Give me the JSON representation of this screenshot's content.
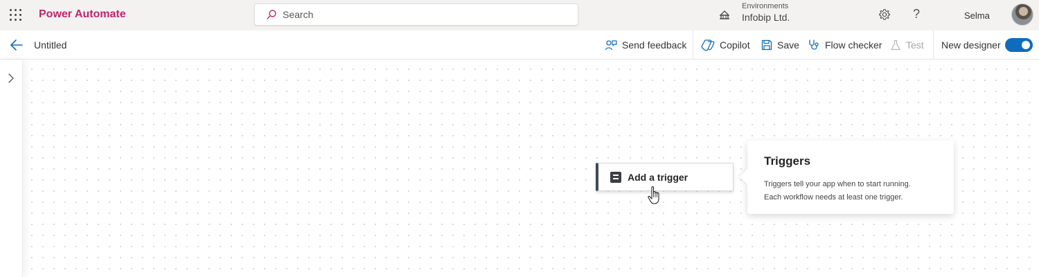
{
  "appbar": {
    "brand": "Power Automate",
    "search_placeholder": "Search",
    "environment_label": "Environments",
    "environment_value": "Infobip Ltd.",
    "help": "?",
    "user_name": "Selma"
  },
  "cmdbar": {
    "title": "Untitled",
    "send_feedback": "Send feedback",
    "copilot": "Copilot",
    "save": "Save",
    "flow_checker": "Flow checker",
    "test": "Test",
    "new_designer": "New designer",
    "new_designer_on": true
  },
  "canvas": {
    "trigger_label": "Add a trigger",
    "callout_title": "Triggers",
    "callout_line1": "Triggers tell your app when to start running.",
    "callout_line2": "Each workflow needs at least one trigger."
  },
  "colors": {
    "brand": "#c1246b",
    "accent": "#0f6cbd"
  }
}
